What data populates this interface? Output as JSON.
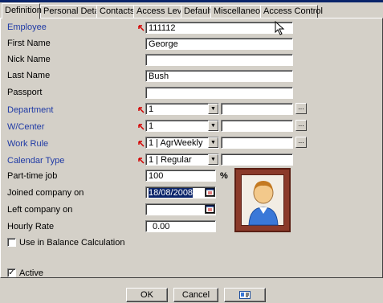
{
  "tabs": [
    "Definition",
    "Personal Details",
    "Contacts",
    "Access Level",
    "Default",
    "Miscellaneous",
    "Access Control"
  ],
  "form": {
    "employee_label": "Employee",
    "employee_value": "111112",
    "first_name_label": "First Name",
    "first_name_value": "George",
    "nick_name_label": "Nick Name",
    "nick_name_value": "",
    "last_name_label": "Last Name",
    "last_name_value": "Bush",
    "passport_label": "Passport",
    "passport_value": "",
    "department_label": "Department",
    "department_value": "1",
    "wcenter_label": "W/Center",
    "wcenter_value": "1",
    "work_rule_label": "Work Rule",
    "work_rule_value": "1  |  AgrWeekly",
    "calendar_type_label": "Calendar Type",
    "calendar_type_value": "1  |  Regular",
    "part_time_label": "Part-time job",
    "part_time_value": "100",
    "percent_sign": "%",
    "joined_label": "Joined company on",
    "joined_value": "18/08/2008",
    "left_label": "Left company on",
    "left_value": "",
    "hourly_label": "Hourly Rate",
    "hourly_value": "0.00",
    "balance_label": "Use in Balance Calculation",
    "active_label": "Active",
    "active_check": "✓"
  },
  "buttons": {
    "ok": "OK",
    "cancel": "Cancel"
  },
  "icons": {
    "required_marker": "red-arrow-icon",
    "calendar": "calendar-icon",
    "photo": "employee-photo",
    "card": "id-card-icon"
  },
  "colors": {
    "label_blue": "#1f3aa5",
    "required_red": "#d40000",
    "title_blue": "#0a246a"
  }
}
